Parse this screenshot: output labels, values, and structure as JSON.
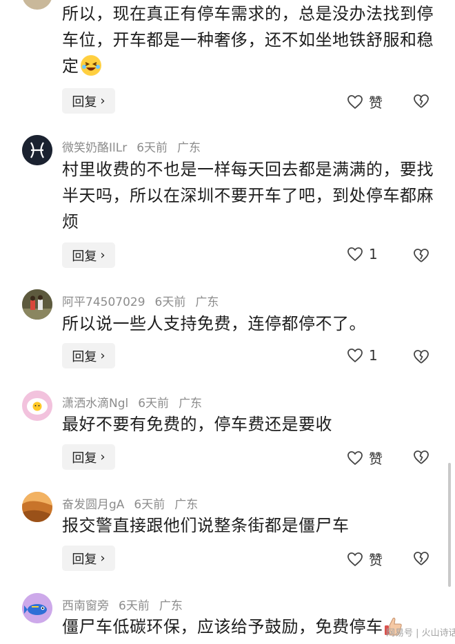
{
  "comments": [
    {
      "text": "所以，现在真正有停车需求的，总是没办法找到停车位，开车都是一种奢侈，还不如坐地铁舒服和稳定",
      "reply_label": "回复",
      "like_label": "赞"
    },
    {
      "username": "微笑奶酪IlLr",
      "time": "6天前",
      "location": "广东",
      "text": "村里收费的不也是一样每天回去都是满满的，要找半天吗，所以在深圳不要开车了吧，到处停车都麻烦",
      "reply_label": "回复",
      "like_label": "1"
    },
    {
      "username": "阿平74507029",
      "time": "6天前",
      "location": "广东",
      "text": "所以说一些人支持免费，连停都停不了。",
      "reply_label": "回复",
      "like_label": "1"
    },
    {
      "username": "潇洒水滴Ngl",
      "time": "6天前",
      "location": "广东",
      "text": "最好不要有免费的，停车费还是要收",
      "reply_label": "回复",
      "like_label": "赞"
    },
    {
      "username": "奋发圆月gA",
      "time": "6天前",
      "location": "广东",
      "text": "报交警直接跟他们说整条街都是僵尸车",
      "reply_label": "回复",
      "like_label": "赞"
    },
    {
      "username": "西南窗旁",
      "time": "6天前",
      "location": "广东",
      "text": "僵尸车低碳环保，应该给予鼓励，免费停车"
    }
  ],
  "watermark": "网易号 | 火山诗话",
  "colors": {
    "meta": "#8c8c8c",
    "button_bg": "#f2f2f2",
    "text": "#1d1d1d"
  },
  "icons": [
    "heart-outline-icon",
    "broken-heart-icon",
    "chevron-right-icon",
    "laughing-emoji-icon",
    "thumbs-up-emoji-icon"
  ]
}
